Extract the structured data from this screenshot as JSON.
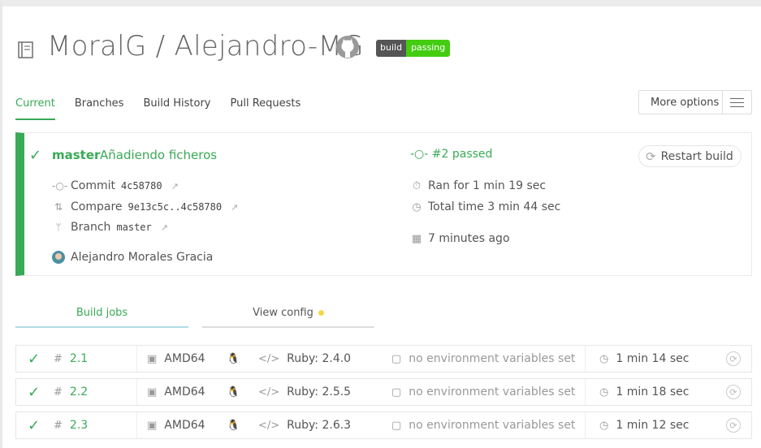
{
  "repo": {
    "title": "MoralG / Alejandro-MG"
  },
  "badge": {
    "left": "build",
    "right": "passing"
  },
  "tabs": [
    {
      "label": "Current"
    },
    {
      "label": "Branches"
    },
    {
      "label": "Build History"
    },
    {
      "label": "Pull Requests"
    }
  ],
  "more_options": {
    "label": "More options"
  },
  "build": {
    "branch": "master",
    "message": "Añadiendo ficheros",
    "commit_label": "Commit",
    "commit_hash": "4c58780",
    "compare_label": "Compare",
    "compare_range": "9e13c5c..4c58780",
    "branch_label": "Branch",
    "branch_value": "master",
    "author": "Alejandro Morales Gracia",
    "status": "#2 passed",
    "ran_for": "Ran for 1 min 19 sec",
    "total_time": "Total time 3 min 44 sec",
    "when": "7 minutes ago",
    "restart_label": "Restart build"
  },
  "subtabs": {
    "jobs": "Build jobs",
    "config": "View config"
  },
  "jobs": [
    {
      "number": "2.1",
      "arch": "AMD64",
      "lang": "Ruby: 2.4.0",
      "env": "no environment variables set",
      "duration": "1 min 14 sec"
    },
    {
      "number": "2.2",
      "arch": "AMD64",
      "lang": "Ruby: 2.5.5",
      "env": "no environment variables set",
      "duration": "1 min 18 sec"
    },
    {
      "number": "2.3",
      "arch": "AMD64",
      "lang": "Ruby: 2.6.3",
      "env": "no environment variables set",
      "duration": "1 min 12 sec"
    }
  ],
  "colors": {
    "accent": "#39aa56",
    "badge_dark": "#555555",
    "badge_green": "#44cc11",
    "dot_yellow": "#f4d74a"
  }
}
